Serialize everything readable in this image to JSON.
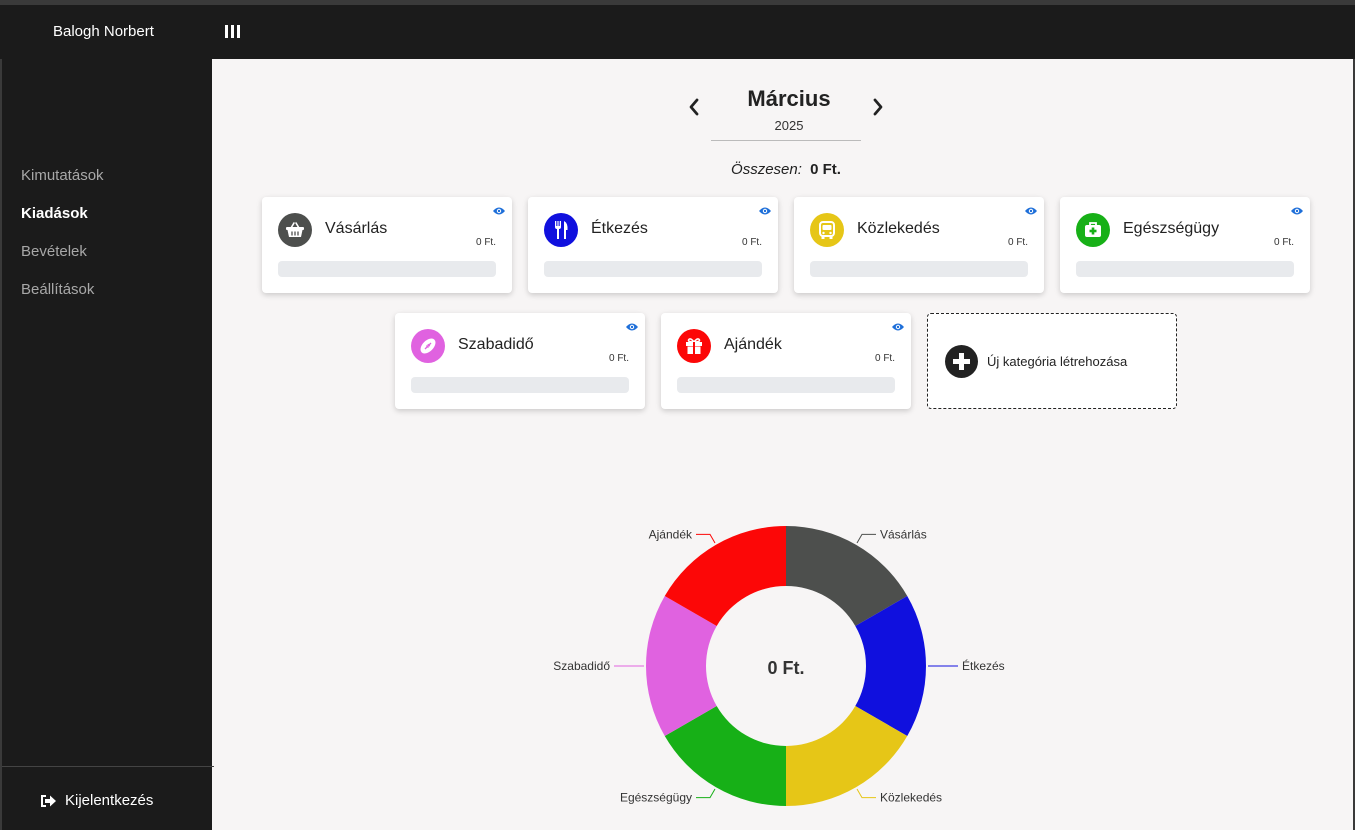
{
  "header": {
    "username": "Balogh Norbert",
    "menu_icon": "menu-bars-icon"
  },
  "sidebar": {
    "items": [
      {
        "label": "Kimutatások",
        "active": false
      },
      {
        "label": "Kiadások",
        "active": true
      },
      {
        "label": "Bevételek",
        "active": false
      },
      {
        "label": "Beállítások",
        "active": false
      }
    ],
    "logout_label": "Kijelentkezés"
  },
  "month_selector": {
    "month": "Március",
    "year": "2025"
  },
  "summary": {
    "label": "Összesen:",
    "value": "0 Ft."
  },
  "categories": [
    {
      "name": "Vásárlás",
      "amount": "0 Ft.",
      "icon": "basket-icon",
      "color": "#4d4f4d"
    },
    {
      "name": "Étkezés",
      "amount": "0 Ft.",
      "icon": "utensils-icon",
      "color": "#1010de"
    },
    {
      "name": "Közlekedés",
      "amount": "0 Ft.",
      "icon": "bus-icon",
      "color": "#e6c617"
    },
    {
      "name": "Egészségügy",
      "amount": "0 Ft.",
      "icon": "medkit-icon",
      "color": "#17b017"
    },
    {
      "name": "Szabadidő",
      "amount": "0 Ft.",
      "icon": "football-icon",
      "color": "#e062e0"
    },
    {
      "name": "Ajándék",
      "amount": "0 Ft.",
      "icon": "gift-icon",
      "color": "#fc0707"
    }
  ],
  "new_category": {
    "label": "Új kategória létrehozása"
  },
  "chart_data": {
    "type": "pie",
    "center_label": "0 Ft.",
    "categories": [
      "Vásárlás",
      "Étkezés",
      "Közlekedés",
      "Egészségügy",
      "Szabadidő",
      "Ajándék"
    ],
    "values": [
      1,
      1,
      1,
      1,
      1,
      1
    ],
    "colors": [
      "#4d4f4d",
      "#1010de",
      "#e6c617",
      "#17b017",
      "#e062e0",
      "#fc0707"
    ]
  }
}
